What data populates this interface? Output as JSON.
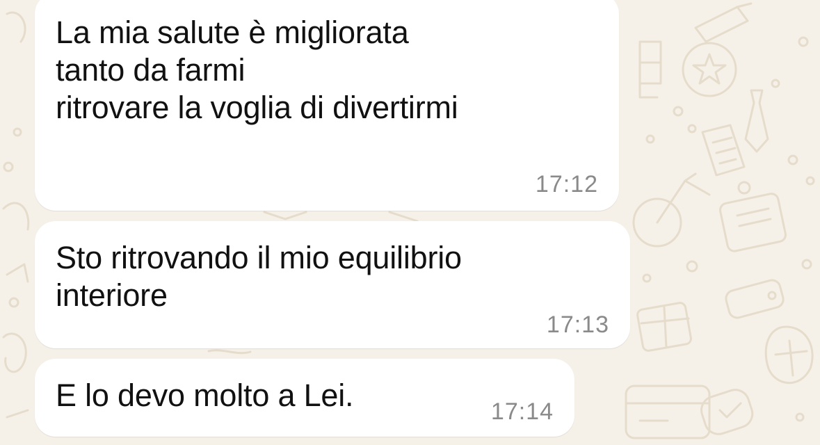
{
  "chat": {
    "background_color": "#f5f0e8",
    "bubble_color": "#ffffff",
    "messages": [
      {
        "text": "La mia salute è migliorata\ntanto da farmi\nritrovare la voglia di divertirmi",
        "time": "17:12"
      },
      {
        "text": "Sto ritrovando il mio equilibrio\ninteriore",
        "time": "17:13"
      },
      {
        "text": "E lo devo molto a Lei.",
        "time": "17:14"
      }
    ]
  }
}
